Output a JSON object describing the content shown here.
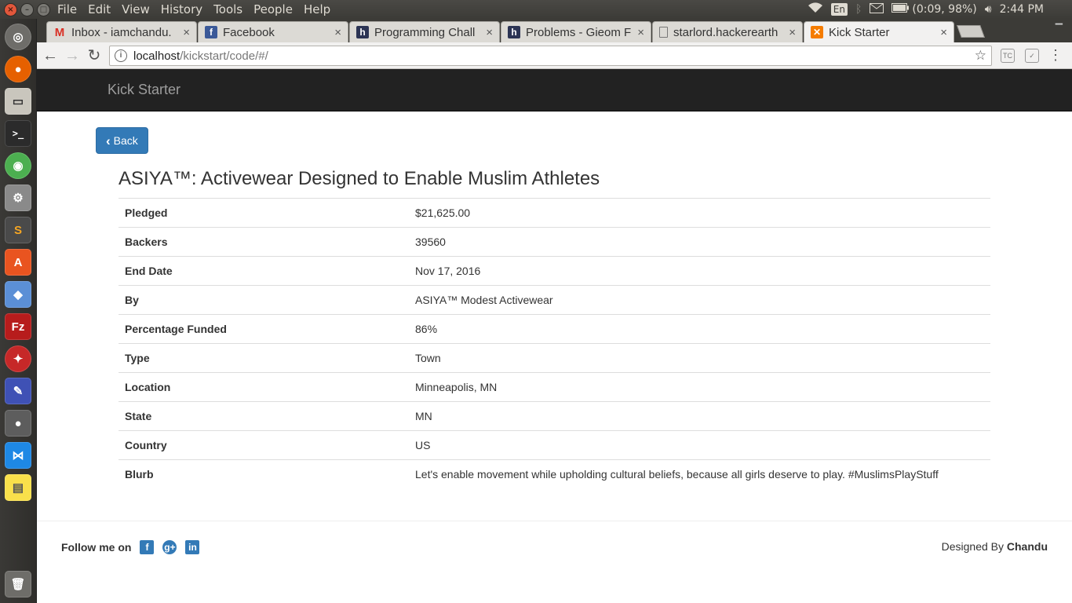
{
  "menubar": {
    "items": [
      "File",
      "Edit",
      "View",
      "History",
      "Tools",
      "People",
      "Help"
    ],
    "lang": "En",
    "battery": "(0:09, 98%)",
    "clock": "2:44 PM"
  },
  "tabs": [
    {
      "title": "Inbox - iamchandu.",
      "favicon": "M"
    },
    {
      "title": "Facebook",
      "favicon": "f"
    },
    {
      "title": "Programming Chall",
      "favicon": "h"
    },
    {
      "title": "Problems - Gieom F",
      "favicon": "h"
    },
    {
      "title": "starlord.hackerearth",
      "favicon": "page"
    },
    {
      "title": "Kick Starter",
      "favicon": "kick"
    }
  ],
  "address": {
    "host": "localhost",
    "path": "/kickstart/code/#/"
  },
  "page": {
    "brand": "Kick Starter",
    "back_label": "Back",
    "title": "ASIYA™: Activewear Designed to Enable Muslim Athletes",
    "details": [
      {
        "key": "Pledged",
        "value": "$21,625.00"
      },
      {
        "key": "Backers",
        "value": "39560"
      },
      {
        "key": "End Date",
        "value": "Nov 17, 2016"
      },
      {
        "key": "By",
        "value": "ASIYA™ Modest Activewear"
      },
      {
        "key": "Percentage Funded",
        "value": "86%"
      },
      {
        "key": "Type",
        "value": "Town"
      },
      {
        "key": "Location",
        "value": "Minneapolis, MN"
      },
      {
        "key": "State",
        "value": "MN"
      },
      {
        "key": "Country",
        "value": "US"
      },
      {
        "key": "Blurb",
        "value": "Let's enable movement while upholding cultural beliefs, because all girls deserve to play. #MuslimsPlayStuff"
      }
    ],
    "footer": {
      "follow": "Follow me on",
      "designed_prefix": "Designed By",
      "designer": "Chandu"
    }
  },
  "colors": {
    "primary": "#337ab7",
    "navbar": "#222222"
  }
}
